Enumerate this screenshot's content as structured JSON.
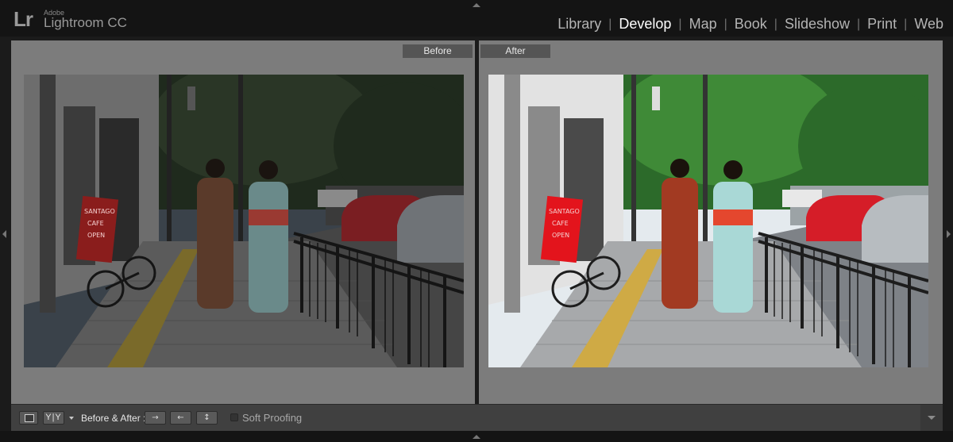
{
  "app": {
    "logo_mark": "Lr",
    "brand_small": "Adobe",
    "brand_name": "Lightroom CC"
  },
  "modules": [
    {
      "label": "Library",
      "active": false
    },
    {
      "label": "Develop",
      "active": true
    },
    {
      "label": "Map",
      "active": false
    },
    {
      "label": "Book",
      "active": false
    },
    {
      "label": "Slideshow",
      "active": false
    },
    {
      "label": "Print",
      "active": false
    },
    {
      "label": "Web",
      "active": false
    }
  ],
  "module_separator": "|",
  "panes": {
    "before_label": "Before",
    "after_label": "After"
  },
  "photo": {
    "sign_text": [
      "SANTAGO",
      "CAFE",
      "OPEN"
    ]
  },
  "toolbar": {
    "yy_label": "Y|Y",
    "before_after_label": "Before & After :",
    "soft_proofing_label": "Soft Proofing",
    "soft_proofing_checked": false
  },
  "colors": {
    "pane_bg": "#7c7c7c",
    "toolbar_bg": "#404040",
    "active_module": "#ffffff",
    "inactive_module": "#b4b4b4"
  }
}
